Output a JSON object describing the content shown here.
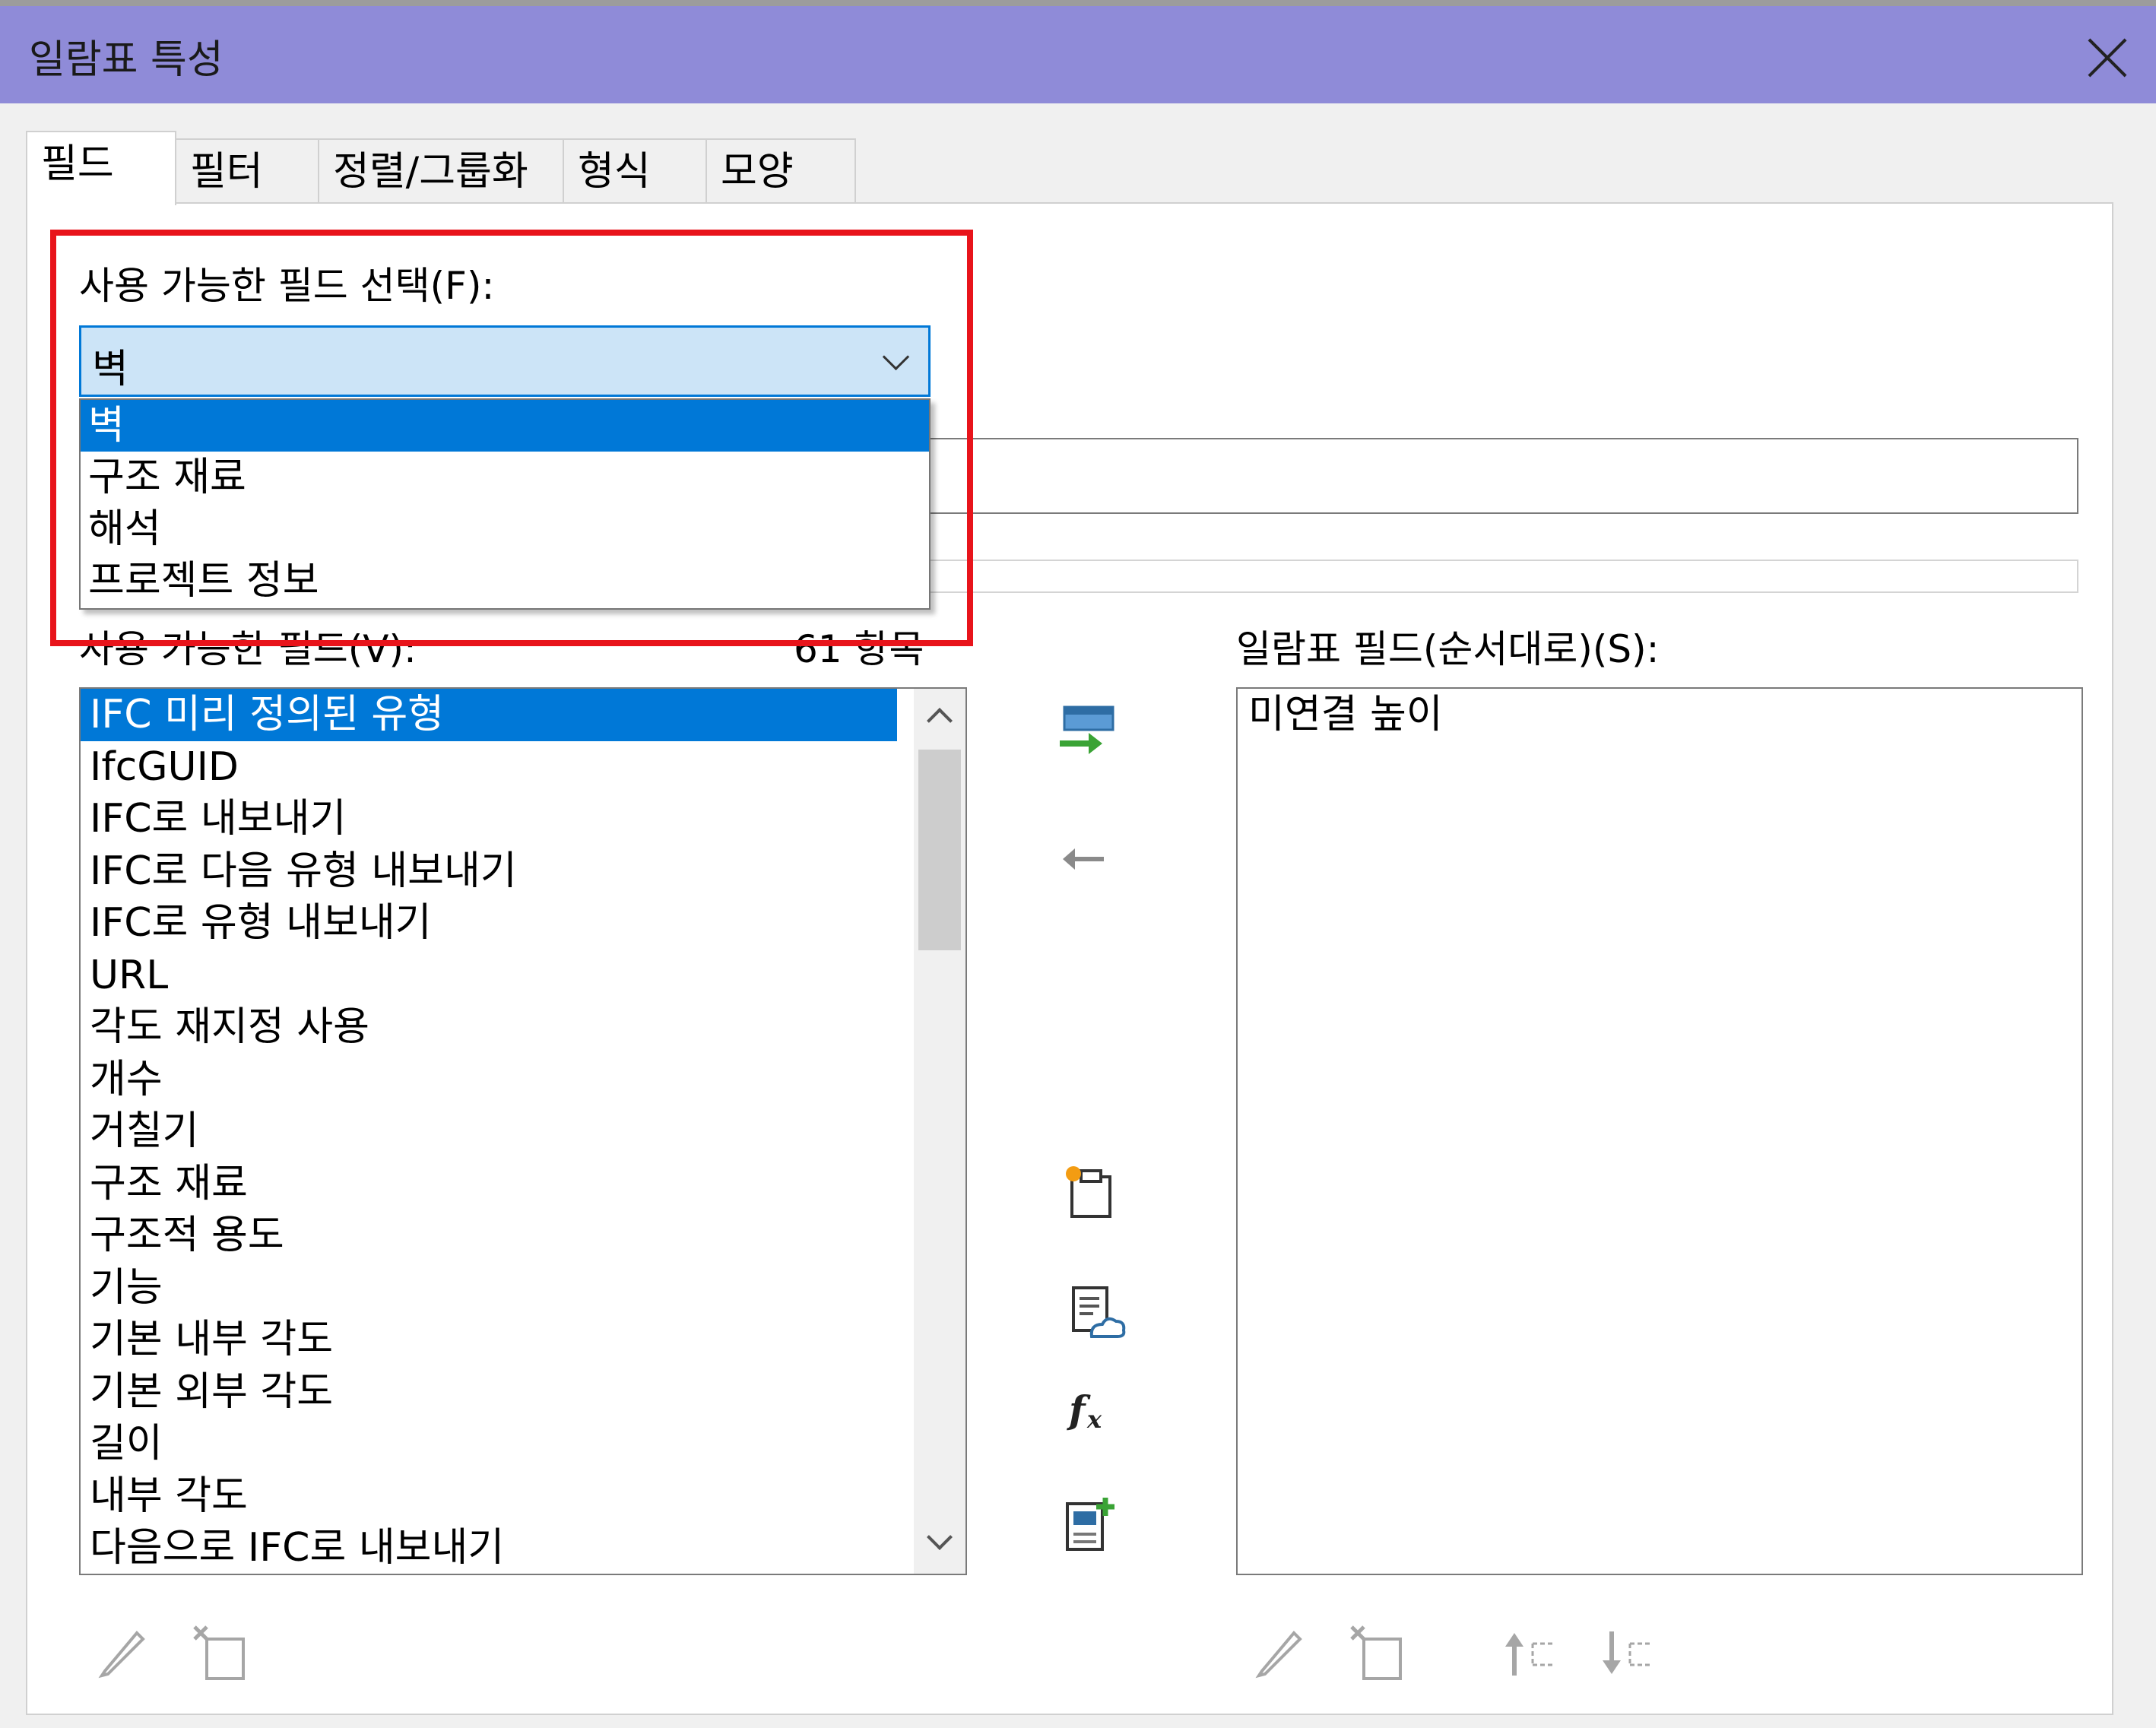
{
  "window": {
    "title": "일람표 특성"
  },
  "tabs": [
    {
      "label": "필드"
    },
    {
      "label": "필터"
    },
    {
      "label": "정렬/그룹화"
    },
    {
      "label": "형식"
    },
    {
      "label": "모양"
    }
  ],
  "category": {
    "label": "사용 가능한 필드 선택(F):",
    "selected": "벽",
    "options": [
      "벽",
      "구조 재료",
      "해석",
      "프로젝트 정보"
    ]
  },
  "available_fields": {
    "label": "사용 가능한 필드(V):",
    "count": "61 항목",
    "items": [
      "IFC 미리 정의된 유형",
      "IfcGUID",
      "IFC로 내보내기",
      "IFC로 다음 유형 내보내기",
      "IFC로 유형 내보내기",
      "URL",
      "각도 재지정 사용",
      "개수",
      "거칠기",
      "구조 재료",
      "구조적 용도",
      "기능",
      "기본 내부 각도",
      "기본 외부 각도",
      "길이",
      "내부 각도",
      "다음으로 IFC로 내보내기"
    ]
  },
  "schedule_fields": {
    "label": "일람표 필드(순서대로)(S):",
    "items": [
      "미연결 높이"
    ]
  },
  "colors": {
    "titlebar": "#8f8bd8",
    "selection": "#0078d7",
    "highlight_box": "#e8141b"
  }
}
